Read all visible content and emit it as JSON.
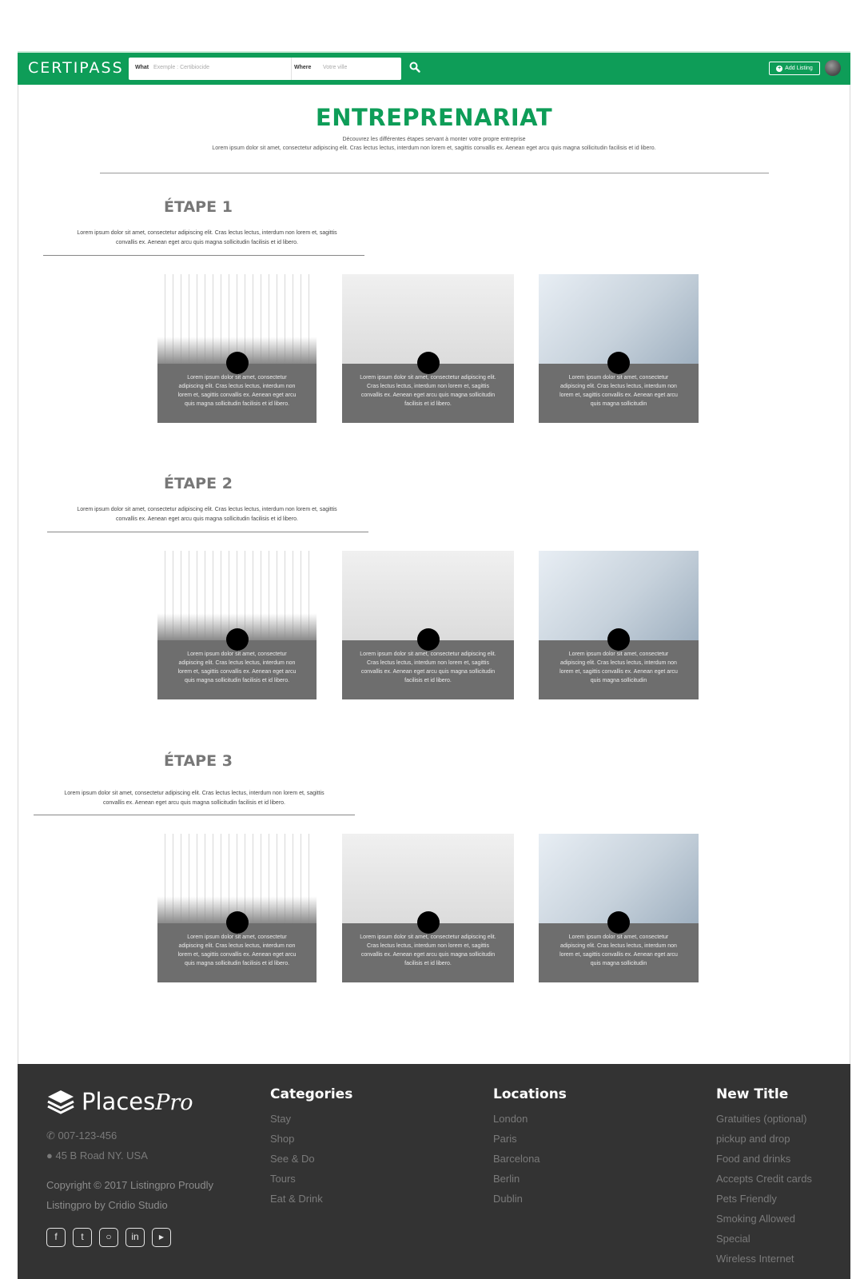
{
  "header": {
    "logo": "CERTIPASS",
    "search_what_label": "What",
    "search_what_placeholder": "Exemple : Certibiocide",
    "search_where_label": "Where",
    "search_where_placeholder": "Votre ville",
    "add_listing_label": "Add Listing",
    "brand_color": "#0e9d58"
  },
  "hero": {
    "title": "ENTREPRENARIAT",
    "subtitle": "Découvrez les différentes étapes servant à monter votre propre entreprise",
    "lead": "Lorem ipsum dolor sit amet, consectetur adipiscing elit. Cras lectus lectus, interdum non lorem et, sagittis convallis ex. Aenean eget arcu quis magna sollicitudin facilisis et id libero."
  },
  "steps": [
    {
      "title": "ÉTAPE 1",
      "desc_line1": "Lorem ipsum dolor sit amet, consectetur adipiscing elit. Cras lectus lectus, interdum non lorem et, sagittis",
      "desc_line2": "convallis ex. Aenean eget arcu quis magna sollicitudin facilisis et id libero.",
      "cards": [
        {
          "text": "Lorem ipsum dolor sit amet, consectetur adipiscing elit. Cras lectus lectus, interdum non lorem et, sagittis convallis ex. Aenean eget arcu quis magna sollicitudin facilisis et id libero."
        },
        {
          "text": "Lorem ipsum dolor sit amet, consectetur adipiscing elit. Cras lectus lectus, interdum non lorem et, sagittis convallis ex. Aenean eget arcu quis magna sollicitudin facilisis et id libero."
        },
        {
          "text": "Lorem ipsum dolor sit amet, consectetur adipiscing elit. Cras lectus lectus, interdum non lorem et, sagittis convallis ex. Aenean eget arcu quis magna sollicitudin"
        }
      ]
    },
    {
      "title": "ÉTAPE 2",
      "desc_line1": "Lorem ipsum dolor sit amet, consectetur adipiscing elit. Cras lectus lectus, interdum non lorem et, sagittis",
      "desc_line2": "convallis ex. Aenean eget arcu quis magna sollicitudin facilisis et id libero.",
      "cards": [
        {
          "text": "Lorem ipsum dolor sit amet, consectetur adipiscing elit. Cras lectus lectus, interdum non lorem et, sagittis convallis ex. Aenean eget arcu quis magna sollicitudin facilisis et id libero."
        },
        {
          "text": "Lorem ipsum dolor sit amet, consectetur adipiscing elit. Cras lectus lectus, interdum non lorem et, sagittis convallis ex. Aenean eget arcu quis magna sollicitudin facilisis et id libero."
        },
        {
          "text": "Lorem ipsum dolor sit amet, consectetur adipiscing elit. Cras lectus lectus, interdum non lorem et, sagittis convallis ex. Aenean eget arcu quis magna sollicitudin"
        }
      ]
    },
    {
      "title": "ÉTAPE 3",
      "desc_line1": "Lorem ipsum dolor sit amet, consectetur adipiscing elit. Cras lectus lectus, interdum non lorem et, sagittis",
      "desc_line2": "convallis ex. Aenean eget arcu quis magna sollicitudin facilisis et id libero.",
      "cards": [
        {
          "text": "Lorem ipsum dolor sit amet, consectetur adipiscing elit. Cras lectus lectus, interdum non lorem et, sagittis convallis ex. Aenean eget arcu quis magna sollicitudin facilisis et id libero."
        },
        {
          "text": "Lorem ipsum dolor sit amet, consectetur adipiscing elit. Cras lectus lectus, interdum non lorem et, sagittis convallis ex. Aenean eget arcu quis magna sollicitudin facilisis et id libero."
        },
        {
          "text": "Lorem ipsum dolor sit amet, consectetur adipiscing elit. Cras lectus lectus, interdum non lorem et, sagittis convallis ex. Aenean eget arcu quis magna sollicitudin"
        }
      ]
    }
  ],
  "footer": {
    "logo_text": "Places",
    "logo_script": "Pro",
    "phone": "007-123-456",
    "address": "45 B Road NY. USA",
    "copyright": "Copyright © 2017 Listingpro Proudly Listingpro by Cridio Studio",
    "socials": [
      "facebook-icon",
      "twitter-icon",
      "instagram-icon",
      "linkedin-icon",
      "youtube-icon"
    ],
    "columns": [
      {
        "title": "Categories",
        "items": [
          "Stay",
          "Shop",
          "See & Do",
          "Tours",
          "Eat & Drink"
        ]
      },
      {
        "title": "Locations",
        "items": [
          "London",
          "Paris",
          "Barcelona",
          "Berlin",
          "Dublin"
        ]
      },
      {
        "title": "New Title",
        "items": [
          "Gratuities (optional)",
          "pickup and drop",
          "Food and drinks",
          "Accepts Credit cards",
          "Pets Friendly",
          "Smoking Allowed",
          "Special",
          "Wireless Internet"
        ]
      }
    ]
  }
}
